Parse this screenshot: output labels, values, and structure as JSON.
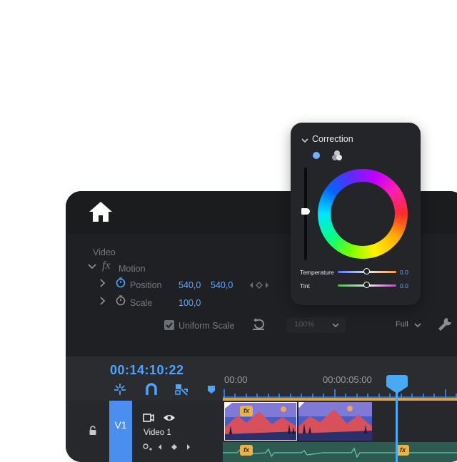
{
  "effect_controls": {
    "section_label": "Video",
    "motion": {
      "fx_icon": "fx",
      "label": "Motion"
    },
    "position": {
      "label": "Position",
      "x": "540,0",
      "y": "540,0"
    },
    "scale": {
      "label": "Scale",
      "value": "100,0"
    },
    "uniform_scale": {
      "label": "Uniform Scale",
      "checked": true
    },
    "zoom": {
      "value": "100%"
    },
    "resolution": {
      "value": "Full"
    }
  },
  "timeline": {
    "timecode": "00:14:10:22",
    "ruler": {
      "start": "00:00",
      "mid": "00:00:05:00"
    },
    "track": {
      "id": "V1",
      "name": "Video 1"
    },
    "clip_effect_badge": "fx"
  },
  "correction_panel": {
    "title": "Correction",
    "temperature": {
      "label": "Temperature",
      "value": "0.0"
    },
    "tint": {
      "label": "Tint",
      "value": "0.0"
    }
  },
  "colors": {
    "accent": "#4da3ff",
    "track_blue": "#4a8ef0",
    "audio_green": "#2f5a52",
    "fx_badge": "#e8b44a",
    "playhead": "#4aa9f5"
  }
}
